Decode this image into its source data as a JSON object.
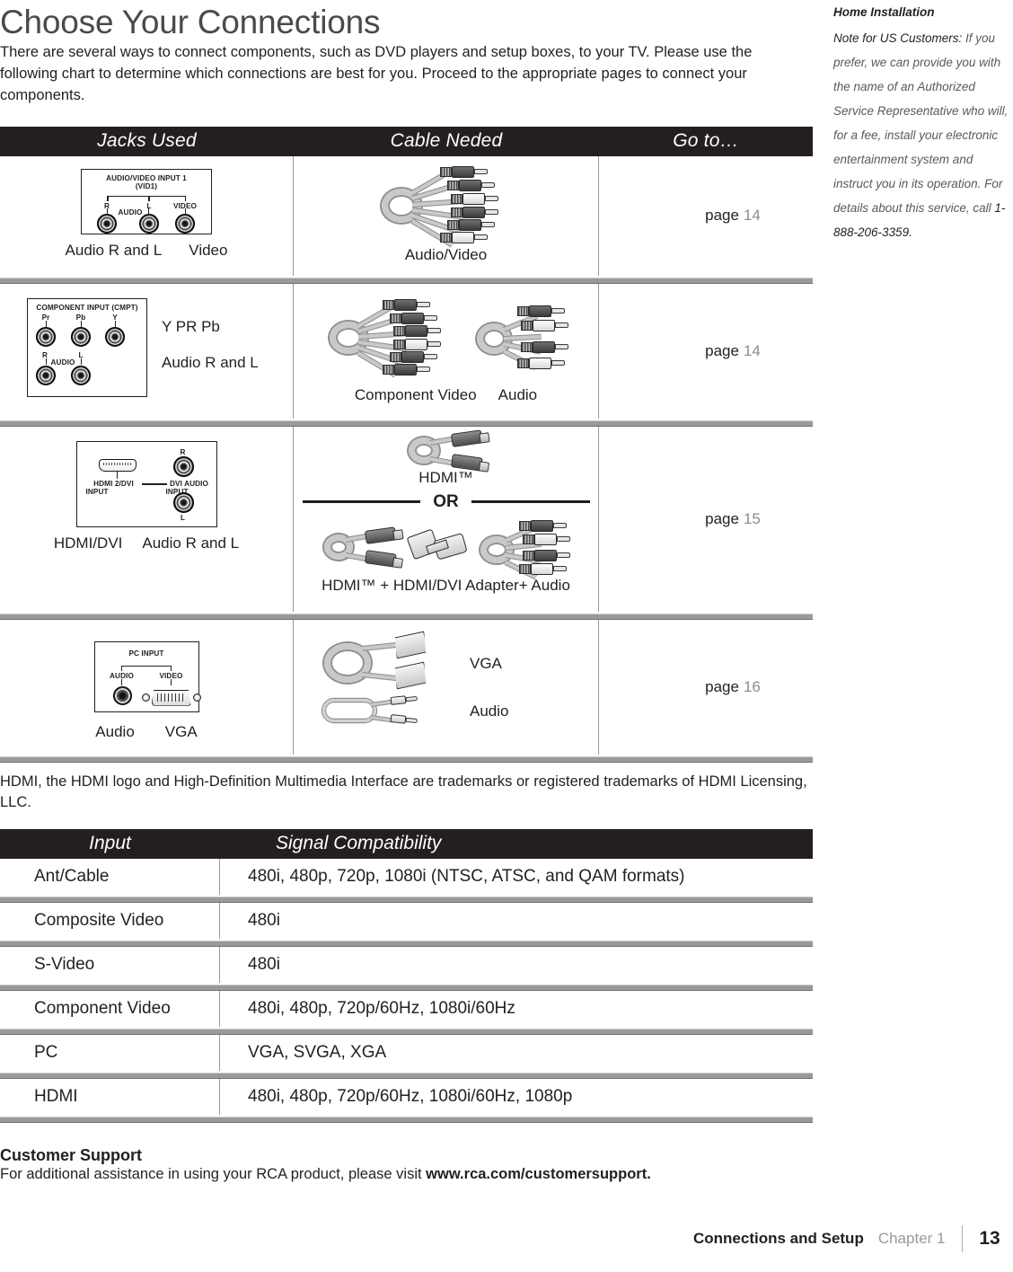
{
  "header": {
    "title": "Choose Your Connections",
    "intro": "There are several ways to connect components, such as DVD players and setup boxes, to your TV. Please use the following chart to determine which connections are best for you. Proceed to the appropriate pages to connect your components."
  },
  "sidenote": {
    "title": "Home Installation",
    "lead": "Note for US Customers:",
    "body": " If you prefer, we can provide you with the name of an Authorized Service Representative who will, for a fee, install your electronic entertainment system and instruct you in its operation. For details about this service, call ",
    "phone": "1-888-206-3359."
  },
  "connections_table": {
    "headers": {
      "jacks": "Jacks Used",
      "cable": "Cable Neded",
      "goto": "Go to…"
    },
    "rows": [
      {
        "panel_title": "AUDIO/VIDEO INPUT 1",
        "panel_subtitle": "(VID1)",
        "jack_labels": [
          "R",
          "L",
          "VIDEO"
        ],
        "jack_group_label": "AUDIO",
        "jack_captions": [
          "Audio R and L",
          "Video"
        ],
        "cable_captions": [
          "Audio/Video"
        ],
        "goto_word": "page",
        "goto_page": "14"
      },
      {
        "panel_title": "COMPONENT INPUT  (CMPT)",
        "jack_labels_top": [
          "Pr",
          "Pb",
          "Y"
        ],
        "jack_labels_bottom": [
          "R",
          "L"
        ],
        "jack_group_label": "AUDIO",
        "side_captions": [
          "Y PR Pb",
          "Audio R and L"
        ],
        "cable_captions": [
          "Component Video",
          "Audio"
        ],
        "goto_word": "page",
        "goto_page": "14"
      },
      {
        "panel_labels": [
          "HDMI 2/DVI",
          "INPUT",
          "DVI AUDIO",
          "INPUT",
          "R",
          "L"
        ],
        "jack_captions": [
          "HDMI/DVI",
          "Audio R and L"
        ],
        "cable_caption_top": "HDMI™",
        "or_label": "OR",
        "cable_caption_bottom": "HDMI™ + HDMI/DVI Adapter+ Audio",
        "goto_word": "page",
        "goto_page": "15"
      },
      {
        "panel_title": "PC INPUT",
        "jack_labels": [
          "AUDIO",
          "VIDEO"
        ],
        "jack_captions": [
          "Audio",
          "VGA"
        ],
        "cable_captions": [
          "VGA",
          "Audio"
        ],
        "goto_word": "page",
        "goto_page": "16"
      }
    ]
  },
  "trademark_note": "HDMI, the HDMI logo and High-Definition Multimedia Interface are trademarks or registered trademarks of HDMI Licensing, LLC.",
  "signal_table": {
    "headers": {
      "input": "Input",
      "signal": "Signal Compatibility"
    },
    "rows": [
      {
        "input": "Ant/Cable",
        "signal": "480i, 480p, 720p, 1080i (NTSC, ATSC, and QAM formats)"
      },
      {
        "input": "Composite Video",
        "signal": "480i"
      },
      {
        "input": "S-Video",
        "signal": "480i"
      },
      {
        "input": "Component Video",
        "signal": "480i, 480p, 720p/60Hz, 1080i/60Hz"
      },
      {
        "input": "PC",
        "signal": "VGA, SVGA, XGA"
      },
      {
        "input": "HDMI",
        "signal": "480i, 480p, 720p/60Hz, 1080i/60Hz, 1080p"
      }
    ]
  },
  "customer_support": {
    "title": "Customer Support",
    "text": "For additional assistance in using your RCA product, please visit ",
    "url": "www.rca.com/customersupport."
  },
  "footer": {
    "chapter_name": "Connections and Setup",
    "chapter": "Chapter 1",
    "page": "13"
  },
  "colors": {
    "header_bar": "#231f20",
    "rule_gray": "#9a9a9a",
    "muted_text": "#8c8c8c",
    "title_gray": "#4a4a4a"
  }
}
